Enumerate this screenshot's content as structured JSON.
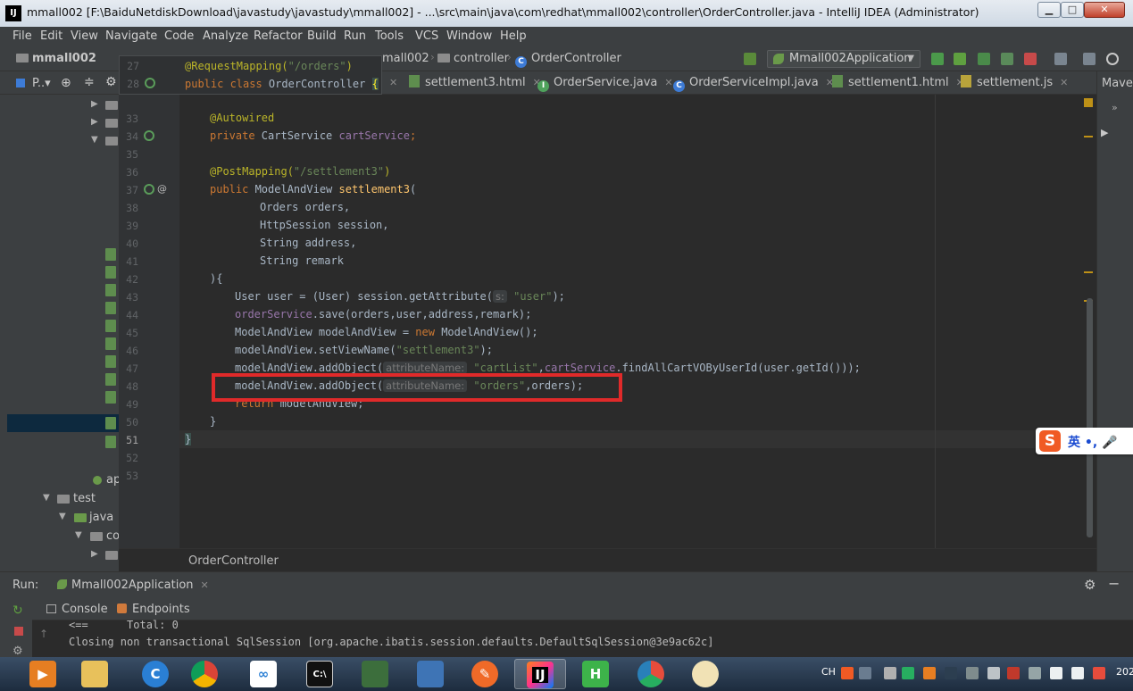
{
  "window": {
    "title": "mmall002 [F:\\BaiduNetdiskDownload\\javastudy\\javastudy\\mmall002] - ...\\src\\main\\java\\com\\redhat\\mmall002\\controller\\OrderController.java - IntelliJ IDEA (Administrator)",
    "app_icon": "IJ",
    "minimize": "▁",
    "maximize": "□",
    "close": "✕"
  },
  "menu": [
    "File",
    "Edit",
    "View",
    "Navigate",
    "Code",
    "Analyze",
    "Refactor",
    "Build",
    "Run",
    "Tools",
    "VCS",
    "Window",
    "Help"
  ],
  "navbar": {
    "project": "mmall002",
    "module": "mall002",
    "package": "controller",
    "file": "OrderController",
    "run_config": "Mmall002Application"
  },
  "project_panel": {
    "title": "P..▾",
    "test_folder": "test",
    "java_folder": "java",
    "co_folder": "co",
    "ap_item": "ap"
  },
  "tabs": [
    {
      "label": "settlement3.html"
    },
    {
      "label": "OrderService.java"
    },
    {
      "label": "OrderServiceImpl.java"
    },
    {
      "label": "settlement1.html"
    },
    {
      "label": "settlement.js"
    }
  ],
  "maven_label": "Mave",
  "sticky": {
    "line1_num": "27",
    "line1_ann": "@RequestMapping(",
    "line1_str": "\"/orders\"",
    "line1_end": ")",
    "line2_num": "28",
    "line2_kw": "public class ",
    "line2_name": "OrderController ",
    "line2_brace": "{"
  },
  "line_numbers": [
    "33",
    "34",
    "35",
    "36",
    "37",
    "38",
    "39",
    "40",
    "41",
    "42",
    "43",
    "44",
    "45",
    "46",
    "47",
    "48",
    "49",
    "50",
    "51",
    "52",
    "53"
  ],
  "code": {
    "l33": "@Autowired",
    "l34_kw": "private ",
    "l34_type": "CartService ",
    "l34_field": "cartService",
    "l34_end": ";",
    "l36_ann": "@PostMapping(",
    "l36_str": "\"/settlement3\"",
    "l36_end": ")",
    "l37_kw": "public ",
    "l37_type": "ModelAndView ",
    "l37_method": "settlement3",
    "l37_end": "(",
    "l38": "Orders orders,",
    "l39": "HttpSession session,",
    "l40": "String address,",
    "l41": "String remark",
    "l42": "){",
    "l43_a": "User user = (User) session.getAttribute(",
    "l43_hint": "s:",
    "l43_str": "\"user\"",
    "l43_end": ");",
    "l44_field": "orderService",
    "l44_rest": ".save(orders,user,address,remark);",
    "l45_a": "ModelAndView modelAndView = ",
    "l45_kw": "new ",
    "l45_b": "ModelAndView();",
    "l46_a": "modelAndView.setViewName(",
    "l46_str": "\"settlement3\"",
    "l46_end": ");",
    "l47_a": "modelAndView.addObject(",
    "l47_hint": "attributeName:",
    "l47_str": "\"cartList\"",
    "l47_comma": ",",
    "l47_field": "cartService",
    "l47_rest": ".findAllCartVOByUserId(user.getId()));",
    "l48_a": "modelAndView.addObject(",
    "l48_hint": "attributeName:",
    "l48_str": "\"orders\"",
    "l48_rest": ",orders);",
    "l49_kw": "return ",
    "l49_rest": "modelAndView;",
    "l50": "}",
    "l51": "}"
  },
  "gutter_at": "@",
  "editor_breadcrumb": "OrderController",
  "run": {
    "label": "Run:",
    "app": "Mmall002Application",
    "console_tab": "Console",
    "endpoints_tab": "Endpoints",
    "line1": "<==      Total: 0",
    "line2": "Closing non transactional SqlSession [org.apache.ibatis.session.defaults.DefaultSqlSession@3e9ac62c]"
  },
  "ime": {
    "logo": "S",
    "text": "英 •, 🎤"
  },
  "taskbar": {
    "ij": "IJ",
    "h": "H",
    "tray_lang": "CH",
    "clock": "202"
  },
  "colors": {
    "editor_bg": "#2b2b2b",
    "keyword": "#cc7832",
    "string": "#6a8759",
    "annotation": "#bbb529",
    "highlight_box": "#e02a2a"
  }
}
